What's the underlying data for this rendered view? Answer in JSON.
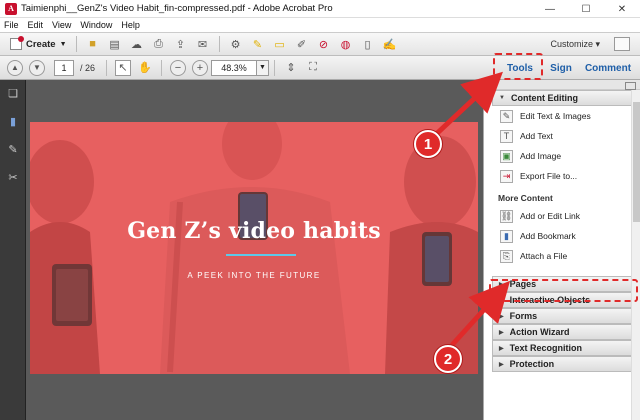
{
  "window": {
    "title": "Taimienphi__GenZ's Video Habit_fin-compressed.pdf - Adobe Acrobat Pro",
    "app_icon_letter": "A"
  },
  "menu": [
    "File",
    "Edit",
    "View",
    "Window",
    "Help"
  ],
  "toolbar": {
    "create_label": "Create",
    "customize_label": "Customize"
  },
  "nav": {
    "current_page": "1",
    "total_pages": "/ 26",
    "zoom": "48.3%"
  },
  "pane_tabs": {
    "tools": "Tools",
    "sign": "Sign",
    "comment": "Comment"
  },
  "document": {
    "title": "Gen Z’s video habits",
    "subtitle": "A PEEK INTO THE FUTURE",
    "accent_color": "#e76060",
    "rule_color": "#5ec8e8"
  },
  "tools_pane": {
    "content_editing": {
      "header": "Content Editing",
      "items": [
        {
          "label": "Edit Text & Images",
          "icon": "edit-text-icon"
        },
        {
          "label": "Add Text",
          "icon": "add-text-icon"
        },
        {
          "label": "Add Image",
          "icon": "add-image-icon"
        },
        {
          "label": "Export File to...",
          "icon": "export-file-icon"
        }
      ],
      "more_label": "More Content",
      "more_items": [
        {
          "label": "Add or Edit Link",
          "icon": "link-icon"
        },
        {
          "label": "Add Bookmark",
          "icon": "bookmark-icon"
        },
        {
          "label": "Attach a File",
          "icon": "attach-icon"
        }
      ]
    },
    "collapsed_sections": [
      "Pages",
      "Interactive Objects",
      "Forms",
      "Action Wizard",
      "Text Recognition",
      "Protection"
    ]
  },
  "annotations": {
    "badge1": "1",
    "badge2": "2",
    "color": "#e02a2a"
  }
}
